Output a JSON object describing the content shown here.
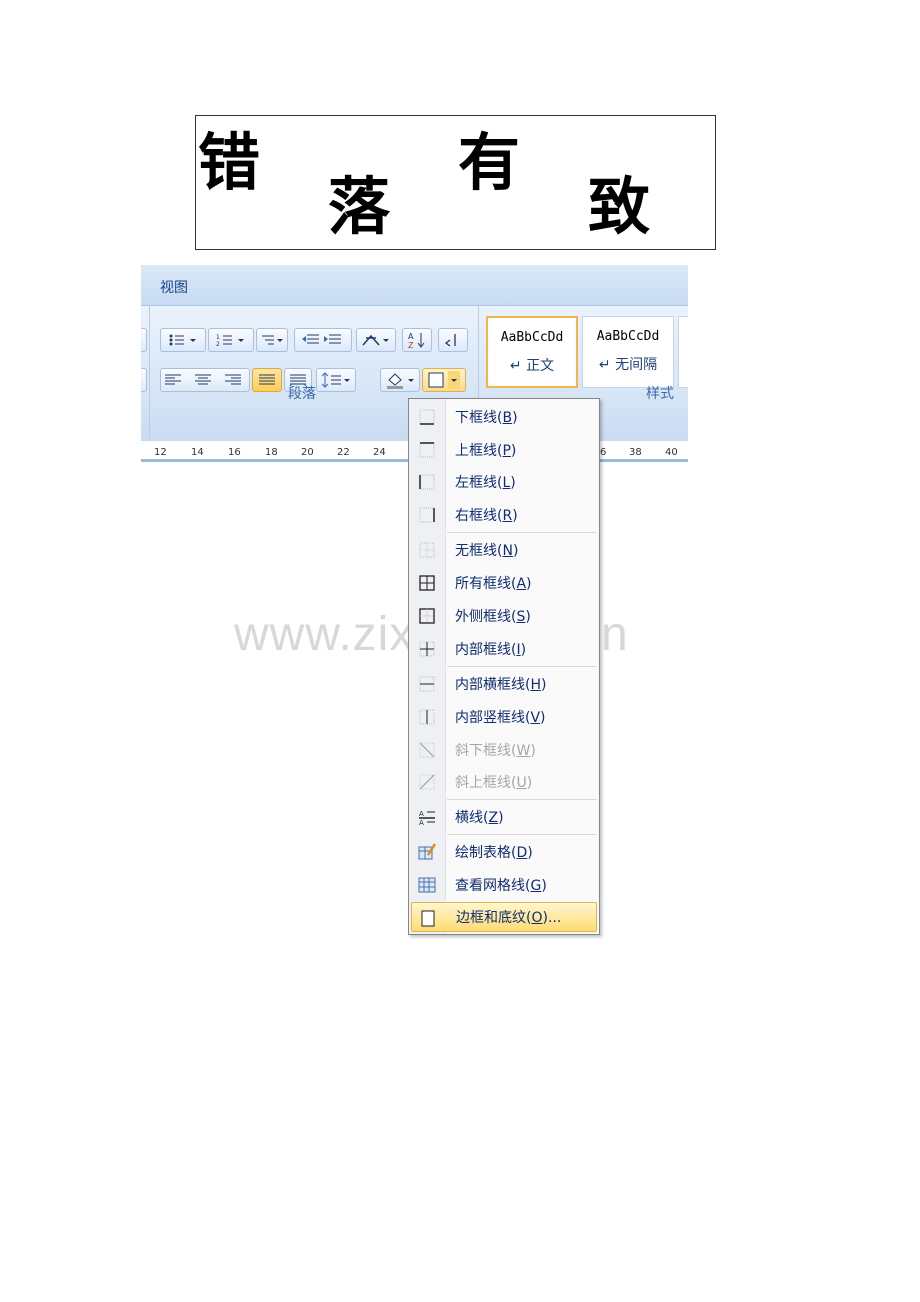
{
  "title": {
    "chars": [
      "错",
      "落",
      "有",
      "致"
    ]
  },
  "ribbon": {
    "tab": "视图",
    "group_paragraph": "段落",
    "group_styles": "样式",
    "styles": [
      {
        "sample": "AaBbCcDd",
        "name": "↵ 正文"
      },
      {
        "sample": "AaBbCcDd",
        "name": "↵ 无间隔"
      }
    ],
    "ruler_ticks": [
      "12",
      "14",
      "16",
      "18",
      "20",
      "22",
      "24",
      "6",
      "38",
      "40"
    ]
  },
  "watermark": "www.zixin.com.cn",
  "menu": {
    "items": [
      {
        "text": "下框线(",
        "key": "B",
        "tail": ")",
        "icon": "bottom-border-icon",
        "disabled": false
      },
      {
        "text": "上框线(",
        "key": "P",
        "tail": ")",
        "icon": "top-border-icon",
        "disabled": false
      },
      {
        "text": "左框线(",
        "key": "L",
        "tail": ")",
        "icon": "left-border-icon",
        "disabled": false
      },
      {
        "text": "右框线(",
        "key": "R",
        "tail": ")",
        "icon": "right-border-icon",
        "disabled": false
      },
      {
        "text": "无框线(",
        "key": "N",
        "tail": ")",
        "icon": "no-border-icon",
        "disabled": false
      },
      {
        "text": "所有框线(",
        "key": "A",
        "tail": ")",
        "icon": "all-borders-icon",
        "disabled": false
      },
      {
        "text": "外侧框线(",
        "key": "S",
        "tail": ")",
        "icon": "outside-borders-icon",
        "disabled": false
      },
      {
        "text": "内部框线(",
        "key": "I",
        "tail": ")",
        "icon": "inside-borders-icon",
        "disabled": false
      },
      {
        "text": "内部横框线(",
        "key": "H",
        "tail": ")",
        "icon": "inside-horizontal-border-icon",
        "disabled": false
      },
      {
        "text": "内部竖框线(",
        "key": "V",
        "tail": ")",
        "icon": "inside-vertical-border-icon",
        "disabled": false
      },
      {
        "text": "斜下框线(",
        "key": "W",
        "tail": ")",
        "icon": "diagonal-down-border-icon",
        "disabled": true
      },
      {
        "text": "斜上框线(",
        "key": "U",
        "tail": ")",
        "icon": "diagonal-up-border-icon",
        "disabled": true
      },
      {
        "text": "横线(",
        "key": "Z",
        "tail": ")",
        "icon": "horizontal-line-icon",
        "disabled": false
      },
      {
        "text": "绘制表格(",
        "key": "D",
        "tail": ")",
        "icon": "draw-table-icon",
        "disabled": false
      },
      {
        "text": "查看网格线(",
        "key": "G",
        "tail": ")",
        "icon": "view-gridlines-icon",
        "disabled": false
      },
      {
        "text": "边框和底纹(",
        "key": "O",
        "tail": ")...",
        "icon": "borders-shading-icon",
        "disabled": false
      }
    ]
  }
}
